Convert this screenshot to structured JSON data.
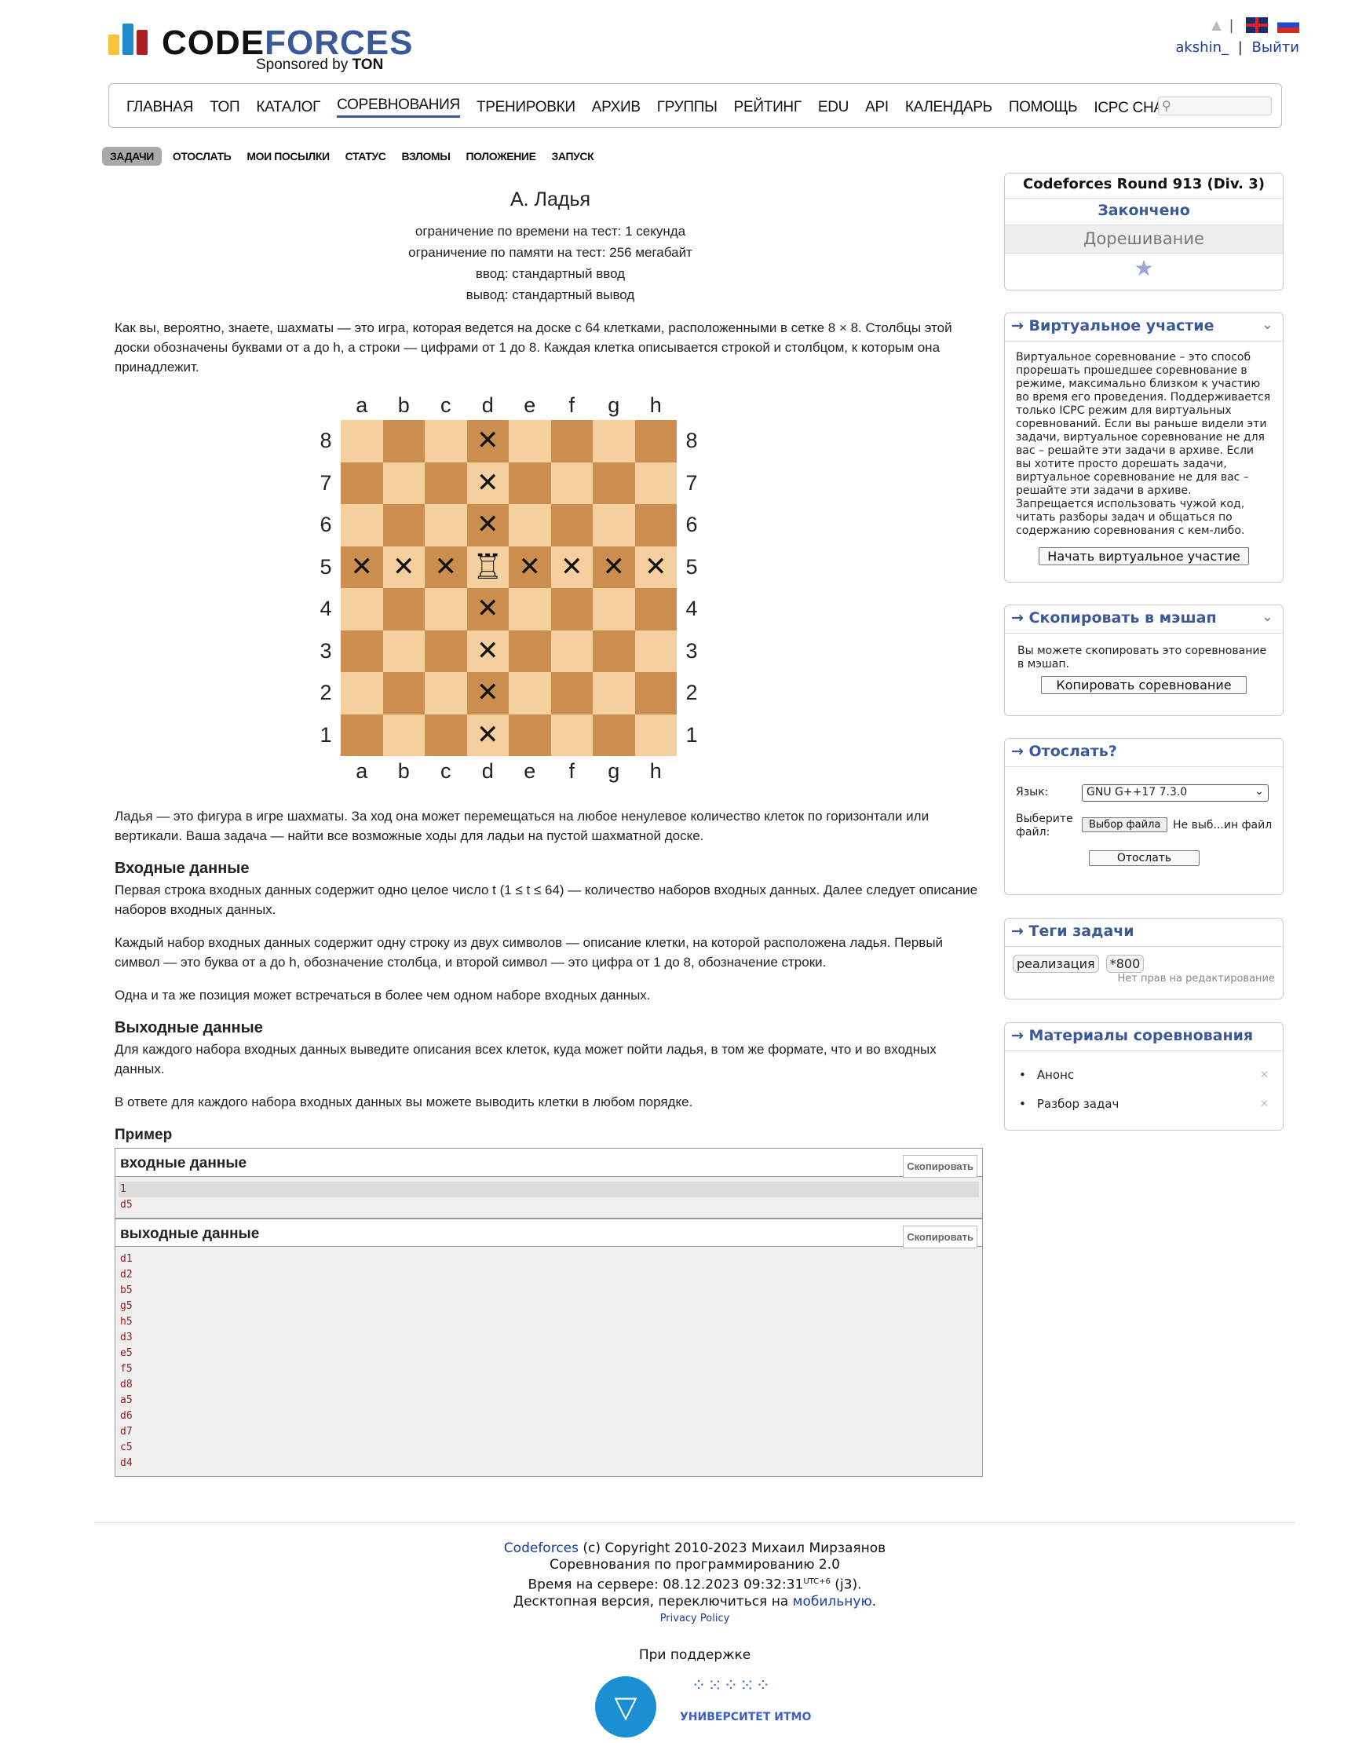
{
  "header": {
    "logo_word_1": "CODE",
    "logo_word_2": "FORCES",
    "sponsor_prefix": "Sponsored by",
    "sponsor_name": "TON",
    "user": "akshin_",
    "separator": "|",
    "logout": "Выйти"
  },
  "menu": [
    "ГЛАВНАЯ",
    "ТОП",
    "КАТАЛОГ",
    "СОРЕВНОВАНИЯ",
    "ТРЕНИРОВКИ",
    "АРХИВ",
    "ГРУППЫ",
    "РЕЙТИНГ",
    "EDU",
    "API",
    "КАЛЕНДАРЬ",
    "ПОМОЩЬ",
    "ICPC CHALLENGE"
  ],
  "submenu": [
    "ЗАДАЧИ",
    "ОТОСЛАТЬ",
    "МОИ ПОСЫЛКИ",
    "СТАТУС",
    "ВЗЛОМЫ",
    "ПОЛОЖЕНИЕ",
    "ЗАПУСК"
  ],
  "problem": {
    "title": "A. Ладья",
    "time_limit": "ограничение по времени на тест: 1 секунда",
    "memory_limit": "ограничение по памяти на тест: 256 мегабайт",
    "input": "ввод: стандартный ввод",
    "output": "вывод: стандартный вывод",
    "intro": "Как вы, вероятно, знаете, шахматы — это игра, которая ведется на доске с 64 клетками, расположенными в сетке 8 × 8. Столбцы этой доски обозначены буквами от a до h, а строки — цифрами от 1 до 8. Каждая клетка описывается строкой и столбцом, к которым она принадлежит.",
    "rook_text": "Ладья — это фигура в игре шахматы. За ход она может перемещаться на любое ненулевое количество клеток по горизонтали или вертикали. Ваша задача — найти все возможные ходы для ладьи на пустой шахматной доске.",
    "input_title": "Входные данные",
    "input_p1": "Первая строка входных данных содержит одно целое число t (1 ≤ t ≤ 64) — количество наборов входных данных. Далее следует описание наборов входных данных.",
    "input_p2": "Каждый набор входных данных содержит одну строку из двух символов — описание клетки, на которой расположена ладья. Первый символ — это буква от a до h, обозначение столбца, и второй символ — это цифра от 1 до 8, обозначение строки.",
    "input_p3": "Одна и та же позиция может встречаться в более чем одном наборе входных данных.",
    "output_title": "Выходные данные",
    "output_p1": "Для каждого набора входных данных выведите описания всех клеток, куда может пойти ладья, в том же формате, что и во входных данных.",
    "output_p2": "В ответе для каждого набора входных данных вы можете выводить клетки в любом порядке.",
    "example_title": "Пример",
    "input_label": "входные  данные",
    "output_label": "выходные  данные",
    "copy": "Скопировать",
    "sample_input": [
      "1",
      "d5"
    ],
    "sample_output": [
      "d1",
      "d2",
      "b5",
      "g5",
      "h5",
      "d3",
      "e5",
      "f5",
      "d8",
      "a5",
      "d6",
      "d7",
      "c5",
      "d4"
    ]
  },
  "board": {
    "files": [
      "a",
      "b",
      "c",
      "d",
      "e",
      "f",
      "g",
      "h"
    ],
    "ranks": [
      "8",
      "7",
      "6",
      "5",
      "4",
      "3",
      "2",
      "1"
    ],
    "rook_square": "d5",
    "colors": {
      "light": "#f5d09e",
      "dark": "#cc8e4e"
    }
  },
  "sidebar": {
    "contest_name": "Codeforces Round 913 (Div. 3)",
    "status": "Закончено",
    "upsolving": "Дорешивание",
    "virtual_title": "→ Виртуальное участие",
    "virtual_text": "Виртуальное соревнование – это способ прорешать прошедшее соревнование в режиме, максимально близком к участию во время его проведения. Поддерживается только ICPC режим для виртуальных соревнований. Если вы раньше видели эти задачи, виртуальное соревнование не для вас – решайте эти задачи в архиве. Если вы хотите просто дорешать задачи, виртуальное соревнование не для вас – решайте эти задачи в архиве. Запрещается использовать чужой код, читать разборы задач и общаться по содержанию соревнования с кем-либо.",
    "virtual_button": "Начать виртуальное участие",
    "mashup_title": "→ Скопировать в мэшап",
    "mashup_text": "Вы можете скопировать это соревнование в мэшап.",
    "mashup_button": "Копировать соревнование",
    "submit_title": "→ Отослать?",
    "lang_label": "Язык:",
    "lang_value": "GNU G++17 7.3.0",
    "file_label": "Выберите файл:",
    "file_button": "Выбор файла",
    "file_status": "Не выб...ин файл",
    "submit_button": "Отослать",
    "tags_title": "→ Теги задачи",
    "tags": [
      "реализация",
      "*800"
    ],
    "tags_note": "Нет прав на редактирование",
    "materials_title": "→ Материалы соревнования",
    "materials": [
      "Анонс",
      "Разбор задач"
    ]
  },
  "footer": {
    "line1_link": "Codeforces",
    "line1_rest": " (c) Copyright 2010-2023 Михаил Мирзаянов",
    "line2": "Соревнования по программированию 2.0",
    "line3_prefix": "Время на сервере: 08.12.2023 09:32:31",
    "line3_sup": "UTC+6",
    "line3_suffix": " (j3).",
    "line4_prefix": "Десктопная версия, переключиться на ",
    "line4_link": "мобильную",
    "line4_suffix": ".",
    "privacy": "Privacy Policy",
    "support": "При поддержке",
    "itmo": "УНИВЕРСИТЕТ ИТМО"
  }
}
